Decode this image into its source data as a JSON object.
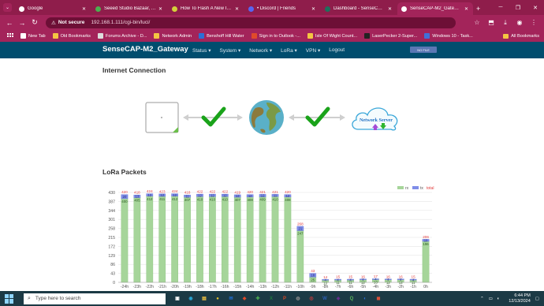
{
  "browser": {
    "tabs": [
      {
        "title": "Google",
        "color": "#ffffff"
      },
      {
        "title": "Seeed Studio Bazaar, The I",
        "color": "#4caf50"
      },
      {
        "title": "How To Flash A New Image",
        "color": "#d4d03a"
      },
      {
        "title": "• Discord | Friends",
        "color": "#5865f2"
      },
      {
        "title": "Dashboard - SenseCAP Cl",
        "color": "#1f6f5c"
      },
      {
        "title": "SenseCAP-M2_Gateway -",
        "color": "#ffffff"
      }
    ],
    "new_tab": "+",
    "security_label": "Not secure",
    "url": "192.168.1.111/cgi-bin/luci/",
    "bookmarks": [
      {
        "label": "New Tab",
        "color": "#ffffff"
      },
      {
        "label": "Old Bookmarks",
        "color": "#f4c542"
      },
      {
        "label": "Forums Archive - D...",
        "color": "#dddddd"
      },
      {
        "label": "Network Admin",
        "color": "#f4c542"
      },
      {
        "label": "Benshoff Hill Water",
        "color": "#2a6fd6"
      },
      {
        "label": "Sign in to Outlook -...",
        "color": "#e04a2a"
      },
      {
        "label": "Isle Of Wight Count...",
        "color": "#f4c542"
      },
      {
        "label": "LaserPecker 2-Super...",
        "color": "#222222"
      },
      {
        "label": "Windows 10 - Task...",
        "color": "#4170d8"
      }
    ],
    "all_bookmarks": "All Bookmarks"
  },
  "router": {
    "brand": "SenseCAP-M2_Gateway",
    "menu": [
      "Status ▾",
      "System ▾",
      "Network ▾",
      "LoRa ▾",
      "VPN ▾",
      "Logout"
    ],
    "badge": "NO FILE"
  },
  "internet": {
    "heading": "Internet Connection",
    "server_label": "Network Server",
    "check_color": "#1aa31a"
  },
  "lora": {
    "heading": "LoRa Packets",
    "legend": [
      "rx",
      "tx",
      "total"
    ],
    "colors": {
      "rx": "#a6d59a",
      "tx": "#7f8de8",
      "total": "#e23b3b"
    }
  },
  "chart_data": {
    "type": "bar",
    "stacked": true,
    "categories": [
      "-24h",
      "-23h",
      "-22h",
      "-21h",
      "-20h",
      "-19h",
      "-18h",
      "-17h",
      "-16h",
      "-15h",
      "-14h",
      "-13h",
      "-12h",
      "-11h",
      "-10h",
      "-9h",
      "-8h",
      "-7h",
      "-6h",
      "-5h",
      "-4h",
      "-3h",
      "-2h",
      "-1h",
      "0h"
    ],
    "yticks": [
      0,
      43,
      86,
      129,
      172,
      215,
      258,
      301,
      344,
      387,
      430
    ],
    "ylim": [
      0,
      430
    ],
    "series": [
      {
        "name": "rx",
        "values": [
          400,
          405,
          412,
          411,
          412,
          407,
          410,
          410,
          410,
          407,
          408,
          409,
          410,
          408,
          247,
          25,
          10,
          11,
          11,
          12,
          13,
          12,
          12,
          11,
          196
        ]
      },
      {
        "name": "tx",
        "values": [
          20,
          13,
          12,
          12,
          12,
          11,
          12,
          12,
          12,
          12,
          12,
          12,
          11,
          12,
          21,
          18,
          4,
          4,
          4,
          4,
          4,
          4,
          4,
          4,
          10
        ]
      },
      {
        "name": "total",
        "values": [
          420,
          418,
          424,
          423,
          424,
          418,
          422,
          422,
          422,
          419,
          420,
          421,
          421,
          420,
          268,
          43,
          14,
          15,
          15,
          16,
          17,
          16,
          16,
          15,
          206
        ]
      }
    ],
    "legend_position": "top-right",
    "grid": true
  },
  "taskbar": {
    "search_placeholder": "Type here to search",
    "apps": [
      {
        "glyph": "▣",
        "color": "#ffffff"
      },
      {
        "glyph": "◉",
        "color": "#2aa6d6"
      },
      {
        "glyph": "▤",
        "color": "#f4c542"
      },
      {
        "glyph": "●",
        "color": "#e5c12a"
      },
      {
        "glyph": "✉",
        "color": "#1f6fd6"
      },
      {
        "glyph": "◆",
        "color": "#e04a2a"
      },
      {
        "glyph": "✚",
        "color": "#4caf50"
      },
      {
        "glyph": "X",
        "color": "#1e7a3e"
      },
      {
        "glyph": "P",
        "color": "#d24726"
      },
      {
        "glyph": "◍",
        "color": "#8a8a8a"
      },
      {
        "glyph": "◎",
        "color": "#cf3b3b"
      },
      {
        "glyph": "W",
        "color": "#2b5fb4"
      },
      {
        "glyph": "◈",
        "color": "#6a2c91"
      },
      {
        "glyph": "Q",
        "color": "#5cb85c"
      },
      {
        "glyph": "◐",
        "color": "#2a6fd6"
      },
      {
        "glyph": "◼",
        "color": "#d8513a"
      }
    ],
    "time": "6:44 PM",
    "date": "12/13/2024"
  }
}
